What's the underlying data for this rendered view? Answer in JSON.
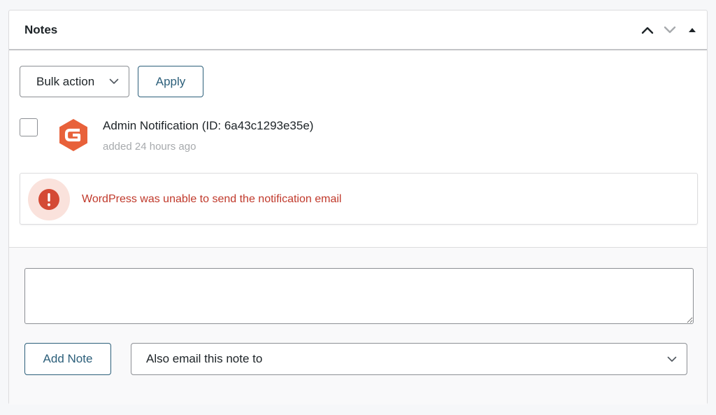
{
  "panel": {
    "title": "Notes",
    "controls": [
      "chevron-up-icon",
      "chevron-down-icon",
      "triangle-up-icon"
    ]
  },
  "toolbar": {
    "bulk_action_label": "Bulk action",
    "apply_label": "Apply"
  },
  "note": {
    "title": "Admin Notification (ID: 6a43c1293e35e)",
    "meta": "added 24 hours ago",
    "avatar_icon": "gravity-forms-logo",
    "avatar_color": "#e8613a"
  },
  "error": {
    "message": "WordPress was unable to send the notification email",
    "icon": "exclamation-icon",
    "color": "#c0392b"
  },
  "composer": {
    "note_placeholder": "",
    "add_note_label": "Add Note",
    "email_select_label": "Also email this note to"
  },
  "colors": {
    "accent": "#2c5f7a",
    "border": "#8c8f94"
  }
}
